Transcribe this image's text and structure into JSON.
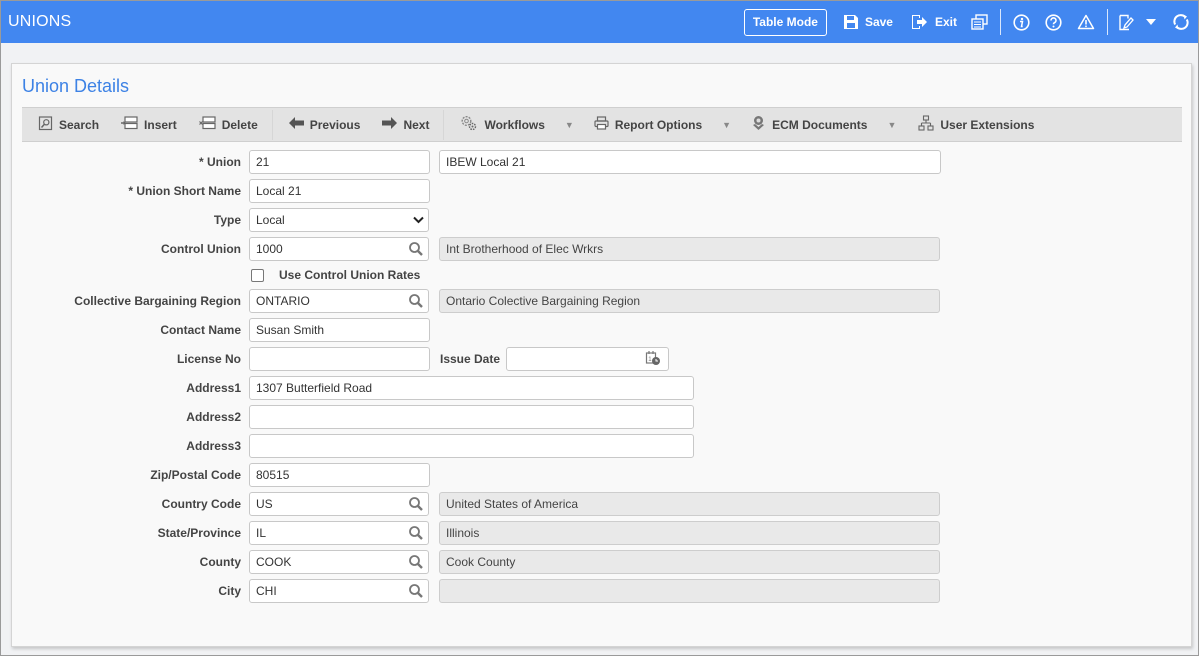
{
  "app": {
    "title": "UNIONS",
    "accent_color": "#4287f0"
  },
  "topbar": {
    "table_mode_label": "Table Mode",
    "save_label": "Save",
    "exit_label": "Exit",
    "icons": [
      "save-icon",
      "exit-icon",
      "report-icon",
      "info-icon",
      "help-icon",
      "warning-icon",
      "edit-note-icon",
      "dropdown-caret-icon",
      "refresh-icon"
    ]
  },
  "panel": {
    "title": "Union Details"
  },
  "toolbar": {
    "search": "Search",
    "insert": "Insert",
    "delete": "Delete",
    "previous": "Previous",
    "next": "Next",
    "workflows": "Workflows",
    "report_options": "Report Options",
    "ecm_documents": "ECM Documents",
    "user_extensions": "User Extensions"
  },
  "form": {
    "union": {
      "label": "* Union",
      "value": "21",
      "description": "IBEW Local 21"
    },
    "union_short_name": {
      "label": "* Union Short Name",
      "value": "Local 21"
    },
    "type": {
      "label": "Type",
      "value": "Local",
      "options": [
        "Local"
      ]
    },
    "control_union": {
      "label": "Control Union",
      "value": "1000",
      "description": "Int Brotherhood of Elec Wrkrs"
    },
    "use_control_union_rates": {
      "label": "Use Control Union Rates",
      "checked": false
    },
    "collective_bargaining_region": {
      "label": "Collective Bargaining Region",
      "value": "ONTARIO",
      "description": "Ontario Colective Bargaining Region"
    },
    "contact_name": {
      "label": "Contact Name",
      "value": "Susan Smith"
    },
    "license_no": {
      "label": "License No",
      "value": ""
    },
    "issue_date": {
      "label": "Issue Date",
      "value": ""
    },
    "address1": {
      "label": "Address1",
      "value": "1307 Butterfield Road"
    },
    "address2": {
      "label": "Address2",
      "value": ""
    },
    "address3": {
      "label": "Address3",
      "value": ""
    },
    "zip": {
      "label": "Zip/Postal Code",
      "value": "80515"
    },
    "country_code": {
      "label": "Country Code",
      "value": "US",
      "description": "United States of America"
    },
    "state_province": {
      "label": "State/Province",
      "value": "IL",
      "description": "Illinois"
    },
    "county": {
      "label": "County",
      "value": "COOK",
      "description": "Cook County"
    },
    "city": {
      "label": "City",
      "value": "CHI",
      "description": ""
    }
  }
}
